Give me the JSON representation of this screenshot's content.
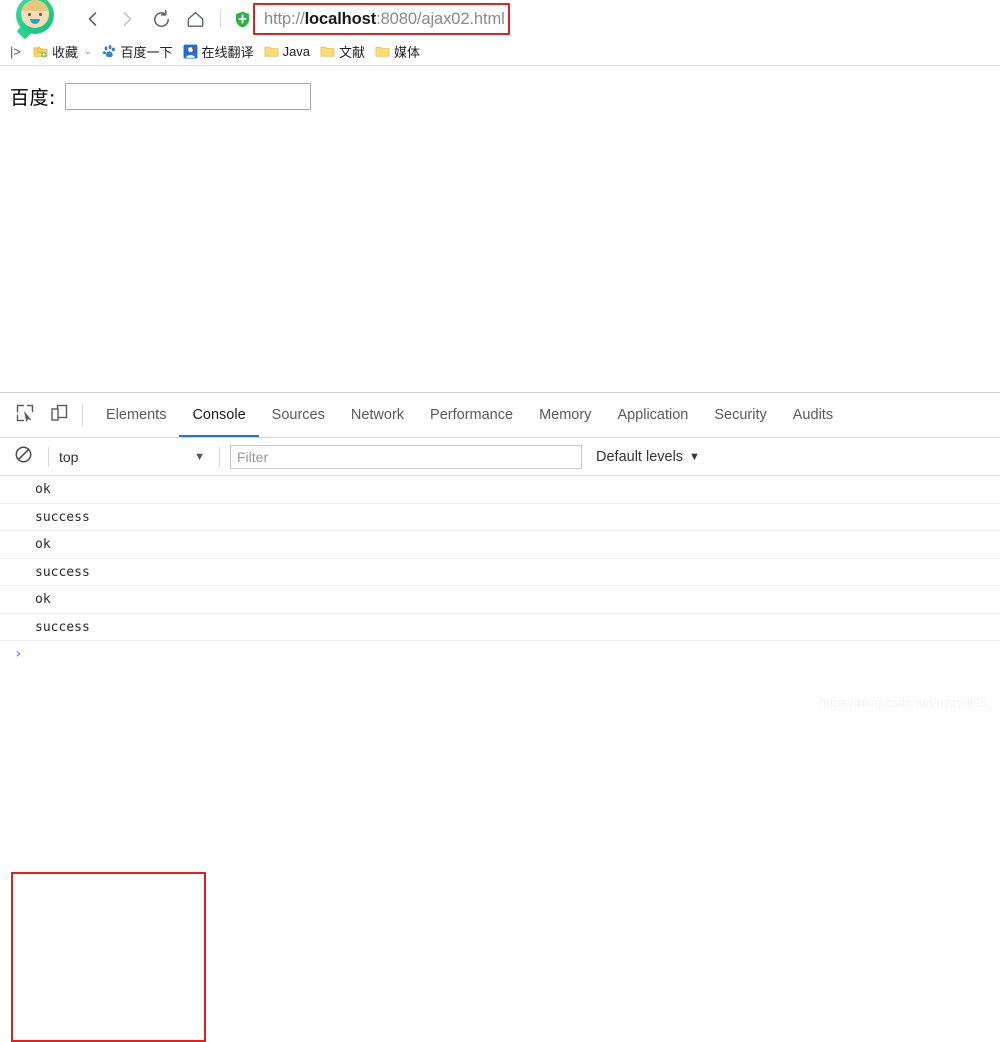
{
  "browser": {
    "nav": {
      "back_label": "Back",
      "forward_label": "Forward",
      "reload_label": "Reload",
      "home_label": "Home"
    },
    "omnibox": {
      "scheme": "http://",
      "host": "localhost",
      "rest": ":8080/ajax02.html",
      "full_url": "http://localhost:8080/ajax02.html",
      "security_icon": "green-shield-icon",
      "annotation_color": "#e32020"
    },
    "bookmarks": {
      "expand_icon": "|>",
      "items": [
        {
          "label": "收藏",
          "icon": "star-folder-icon",
          "has_chevron": true,
          "chevron": "⌄"
        },
        {
          "label": "百度一下",
          "icon": "baidu-paw-icon",
          "has_chevron": false
        },
        {
          "label": "在线翻译",
          "icon": "translate-person-icon",
          "has_chevron": false
        },
        {
          "label": "Java",
          "icon": "folder-icon",
          "has_chevron": false
        },
        {
          "label": "文献",
          "icon": "folder-icon",
          "has_chevron": false
        },
        {
          "label": "媒体",
          "icon": "folder-icon",
          "has_chevron": false
        }
      ]
    }
  },
  "page": {
    "label": "百度:",
    "input_value": "",
    "input_placeholder": ""
  },
  "devtools": {
    "inspect_icon": "inspect-element-icon",
    "device_icon": "device-toolbar-icon",
    "tabs": [
      {
        "label": "Elements",
        "active": false
      },
      {
        "label": "Console",
        "active": true
      },
      {
        "label": "Sources",
        "active": false
      },
      {
        "label": "Network",
        "active": false
      },
      {
        "label": "Performance",
        "active": false
      },
      {
        "label": "Memory",
        "active": false
      },
      {
        "label": "Application",
        "active": false
      },
      {
        "label": "Security",
        "active": false
      },
      {
        "label": "Audits",
        "active": false
      }
    ],
    "active_tab_underline_color": "#1a73e8",
    "console_toolbar": {
      "clear_icon": "clear-console-icon",
      "context": "top",
      "context_caret": "▼",
      "filter_value": "",
      "filter_placeholder": "Filter",
      "levels": "Default levels",
      "levels_caret": "▼"
    },
    "console_messages": [
      {
        "text": "ok"
      },
      {
        "text": "success"
      },
      {
        "text": "ok"
      },
      {
        "text": "success"
      },
      {
        "text": "ok"
      },
      {
        "text": "success"
      }
    ],
    "console_prompt_symbol": "›",
    "annotation_color": "#e32020"
  },
  "watermark": "https://blog.csdn.net/nzzynl95_"
}
